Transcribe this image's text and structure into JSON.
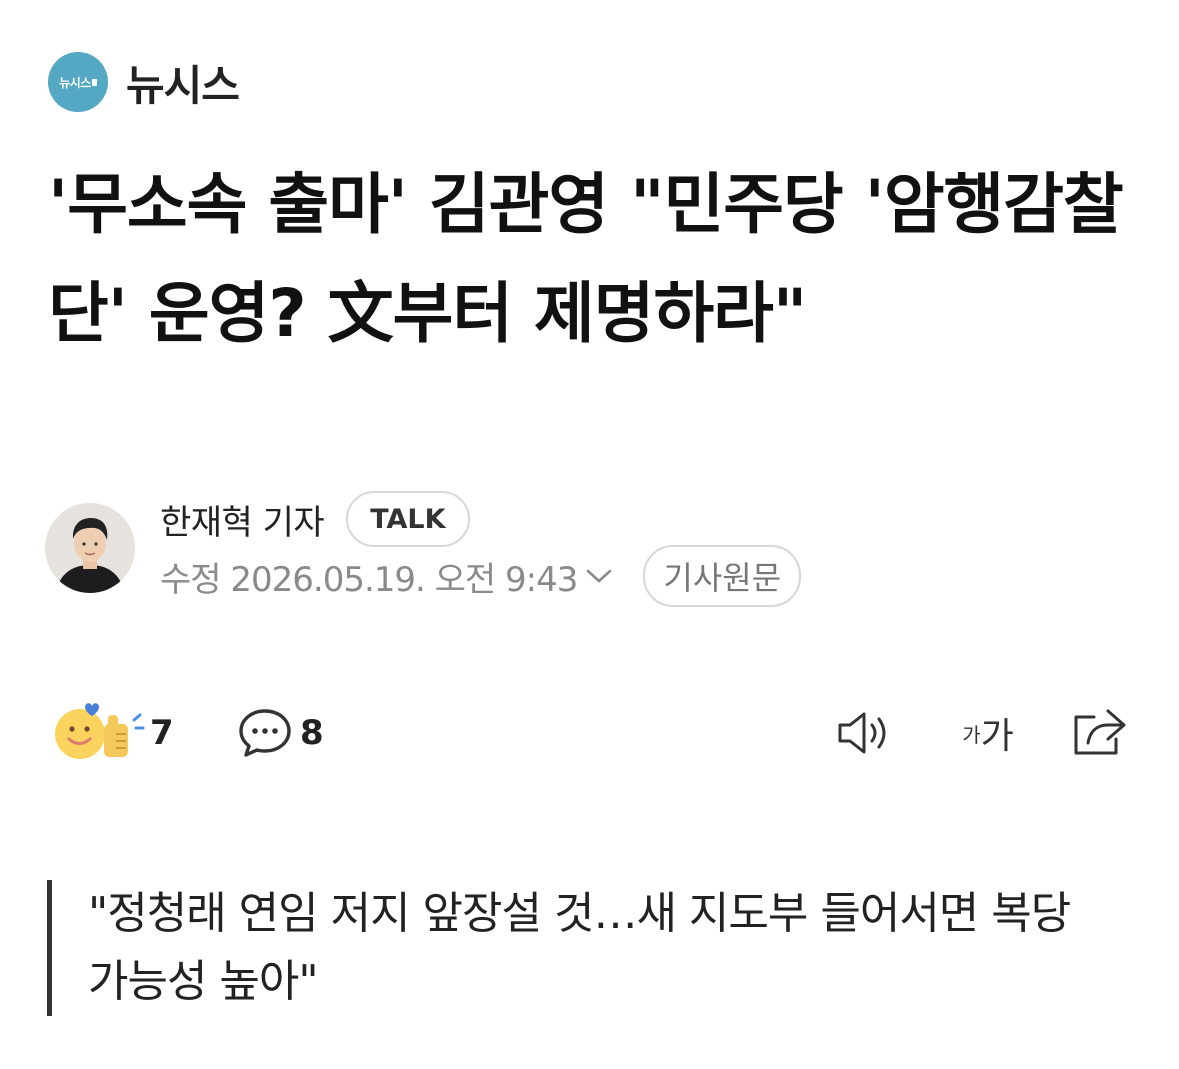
{
  "publisher": {
    "logo_text": "뉴시스",
    "name": "뉴시스",
    "brand_color": "#54a8c4"
  },
  "article": {
    "headline": "'무소속 출마' 김관영 \"민주당 '암행감찰단' 운영? 文부터 제명하라\"",
    "subheadline": "\"정청래 연임 저지 앞장설 것…새 지도부 들어서면 복당 가능성 높아\""
  },
  "reporter": {
    "name": "한재혁 기자",
    "talk_label": "TALK",
    "avatar_icon": "reporter-photo"
  },
  "meta": {
    "date_text": "수정 2026.05.19. 오전 9:43",
    "original_label": "기사원문"
  },
  "actions": {
    "reaction_count": "7",
    "comment_count": "8",
    "reaction_icon": "smile-thumbs-up-icon",
    "comment_icon": "speech-bubble-icon",
    "audio_icon": "speaker-icon",
    "font_small": "가",
    "font_large": "가",
    "share_icon": "share-icon"
  }
}
